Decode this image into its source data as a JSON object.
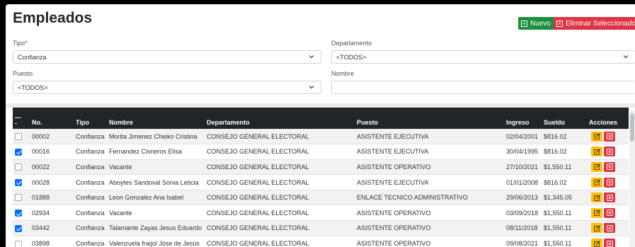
{
  "page": {
    "title": "Empleados"
  },
  "toolbar": {
    "new_label": "Nuevo",
    "delete_selected_label": "Eliminar Seleccionados"
  },
  "filters": {
    "tipo": {
      "label": "Tipo*",
      "value": "Confianza"
    },
    "departamento": {
      "label": "Departamento",
      "value": "<TODOS>"
    },
    "puesto": {
      "label": "Puesto",
      "value": "<TODOS>"
    },
    "nombre": {
      "label": "Nombre",
      "value": ""
    }
  },
  "table": {
    "headers": {
      "select": "---\n-",
      "no": "No.",
      "tipo": "Tipo",
      "nombre": "Nombre",
      "departamento": "Departamento",
      "puesto": "Puesto",
      "ingreso": "Ingreso",
      "sueldo": "Sueldo",
      "acciones": "Acciones"
    },
    "rows": [
      {
        "checked": false,
        "no": "00002",
        "tipo": "Confianza",
        "nombre": "Morita Jimenez Chieko Cristina",
        "departamento": "CONSEJO GENERAL ELECTORAL",
        "puesto": "ASISTENTE EJECUTIVA",
        "ingreso": "02/04/2001",
        "sueldo": "$816.02"
      },
      {
        "checked": true,
        "no": "00016",
        "tipo": "Confianza",
        "nombre": "Fernandez Cisneros Elisa",
        "departamento": "CONSEJO GENERAL ELECTORAL",
        "puesto": "ASISTENTE EJECUTIVA",
        "ingreso": "30/04/1995",
        "sueldo": "$816.02"
      },
      {
        "checked": false,
        "no": "00022",
        "tipo": "Confianza",
        "nombre": "Vacante",
        "departamento": "CONSEJO GENERAL ELECTORAL",
        "puesto": "ASISTENTE OPERATIVO",
        "ingreso": "27/10/2021",
        "sueldo": "$1,550.11"
      },
      {
        "checked": true,
        "no": "00028",
        "tipo": "Confianza",
        "nombre": "Aboytes Sandoval Sonia Leticia",
        "departamento": "CONSEJO GENERAL ELECTORAL",
        "puesto": "ASISTENTE EJECUTIVA",
        "ingreso": "01/01/2008",
        "sueldo": "$816.02"
      },
      {
        "checked": false,
        "no": "01888",
        "tipo": "Confianza",
        "nombre": "Leon Gonzalez Ana Isabel",
        "departamento": "CONSEJO GENERAL ELECTORAL",
        "puesto": "ENLACE TECNICO ADMINISTRATIVO",
        "ingreso": "29/06/2013",
        "sueldo": "$1,345.05"
      },
      {
        "checked": true,
        "no": "02934",
        "tipo": "Confianza",
        "nombre": "Vacante",
        "departamento": "CONSEJO GENERAL ELECTORAL",
        "puesto": "ASISTENTE OPERATIVO",
        "ingreso": "03/09/2018",
        "sueldo": "$1,550.11"
      },
      {
        "checked": true,
        "no": "03442",
        "tipo": "Confianza",
        "nombre": "Talamante Zayas Jesus Eduardo",
        "departamento": "CONSEJO GENERAL ELECTORAL",
        "puesto": "ASISTENTE OPERATIVO",
        "ingreso": "08/11/2018",
        "sueldo": "$1,550.11"
      },
      {
        "checked": false,
        "no": "03898",
        "tipo": "Confianza",
        "nombre": "Valenzuela fraijol Jóse de Jesús",
        "departamento": "CONSEJO GENERAL ELECTORAL",
        "puesto": "ASISTENTE OPERATIVO",
        "ingreso": "09/08/2021",
        "sueldo": "$1,550.11"
      }
    ]
  },
  "icons": {
    "new": "plus-square-icon",
    "delete": "x-square-icon",
    "edit": "pencil-square-icon",
    "caret": "chevron-down-icon"
  },
  "colors": {
    "success": "#1e8e3e",
    "danger": "#dc3545",
    "warning": "#ffc107",
    "primary": "#0d6efd",
    "header_dark": "#212529"
  }
}
